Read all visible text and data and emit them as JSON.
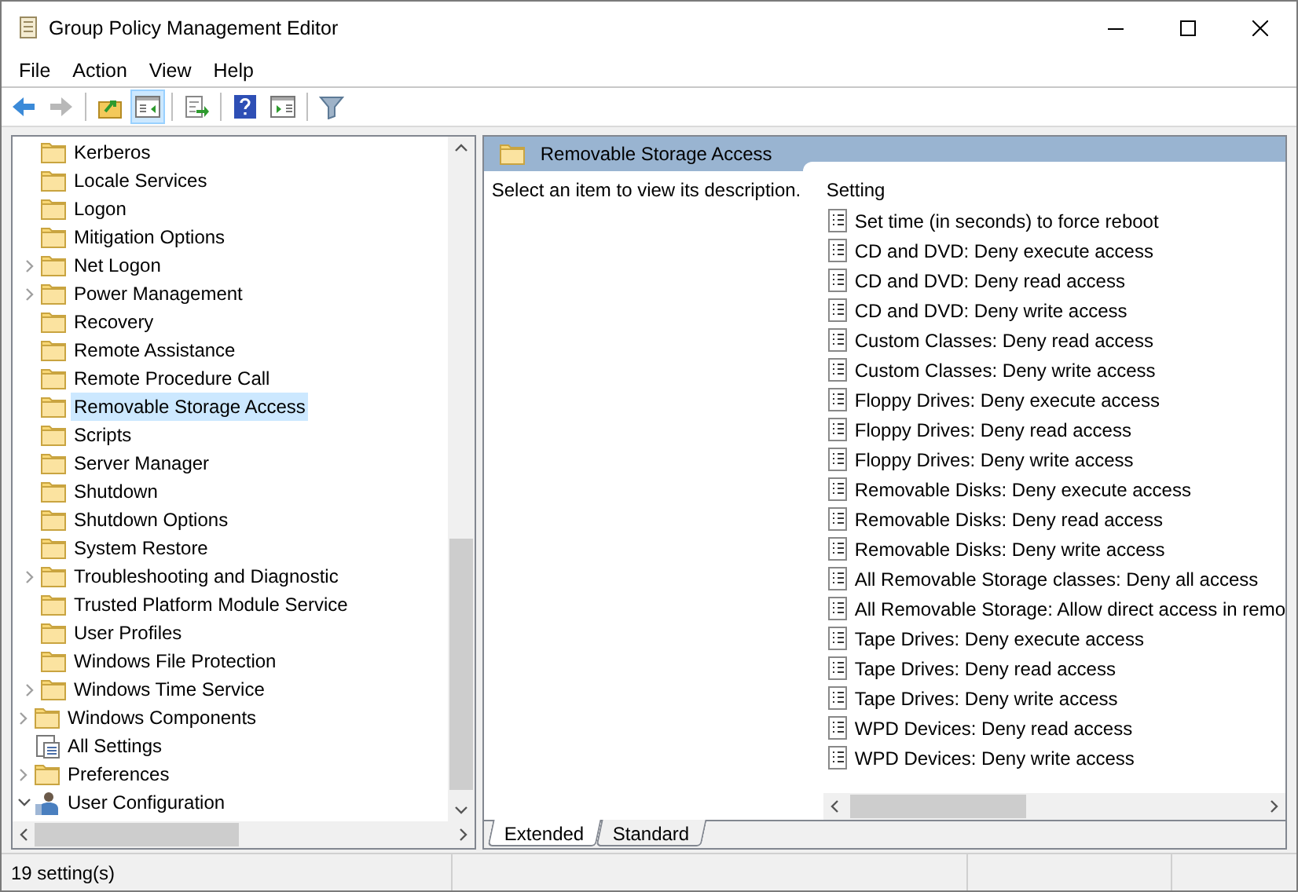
{
  "window": {
    "title": "Group Policy Management Editor"
  },
  "menu": [
    "File",
    "Action",
    "View",
    "Help"
  ],
  "toolbar": [
    {
      "kind": "back",
      "pressed": false,
      "disabled": false
    },
    {
      "kind": "forward",
      "pressed": false,
      "disabled": true
    },
    {
      "kind": "sep"
    },
    {
      "kind": "up",
      "pressed": false,
      "disabled": false
    },
    {
      "kind": "tree",
      "pressed": true,
      "disabled": false
    },
    {
      "kind": "sep"
    },
    {
      "kind": "export",
      "pressed": false,
      "disabled": false
    },
    {
      "kind": "sep"
    },
    {
      "kind": "help",
      "pressed": false,
      "disabled": false
    },
    {
      "kind": "pane",
      "pressed": false,
      "disabled": false
    },
    {
      "kind": "sep"
    },
    {
      "kind": "filter",
      "pressed": false,
      "disabled": false
    }
  ],
  "tree": [
    {
      "children": [
        {
          "children": [
            {
              "children": [
                {
                  "label": "Kerberos",
                  "kind": "folder",
                  "selected": false
                },
                {
                  "label": "Locale Services",
                  "kind": "folder",
                  "selected": false
                },
                {
                  "label": "Logon",
                  "kind": "folder",
                  "selected": false
                },
                {
                  "label": "Mitigation Options",
                  "kind": "folder",
                  "selected": false
                },
                {
                  "label": "Net Logon",
                  "kind": "folder",
                  "expanded": false,
                  "selected": false
                },
                {
                  "label": "Power Management",
                  "kind": "folder",
                  "expanded": false,
                  "selected": false
                },
                {
                  "label": "Recovery",
                  "kind": "folder",
                  "selected": false
                },
                {
                  "label": "Remote Assistance",
                  "kind": "folder",
                  "selected": false
                },
                {
                  "label": "Remote Procedure Call",
                  "kind": "folder",
                  "selected": false
                },
                {
                  "label": "Removable Storage Access",
                  "kind": "folder",
                  "selected": true
                },
                {
                  "label": "Scripts",
                  "kind": "folder",
                  "selected": false
                },
                {
                  "label": "Server Manager",
                  "kind": "folder",
                  "selected": false
                },
                {
                  "label": "Shutdown",
                  "kind": "folder",
                  "selected": false
                },
                {
                  "label": "Shutdown Options",
                  "kind": "folder",
                  "selected": false
                },
                {
                  "label": "System Restore",
                  "kind": "folder",
                  "selected": false
                },
                {
                  "label": "Troubleshooting and Diagnostic",
                  "kind": "folder",
                  "expanded": false,
                  "selected": false
                },
                {
                  "label": "Trusted Platform Module Service",
                  "kind": "folder",
                  "selected": false
                },
                {
                  "label": "User Profiles",
                  "kind": "folder",
                  "selected": false
                },
                {
                  "label": "Windows File Protection",
                  "kind": "folder",
                  "selected": false
                },
                {
                  "label": "Windows Time Service",
                  "kind": "folder",
                  "expanded": false,
                  "selected": false
                }
              ]
            },
            {
              "label": "Windows Components",
              "kind": "folder",
              "expanded": false,
              "selected": false
            },
            {
              "label": "All Settings",
              "kind": "settings",
              "selected": false
            }
          ]
        },
        {
          "label": "Preferences",
          "kind": "folder",
          "expanded": false,
          "selected": false
        }
      ]
    },
    {
      "label": "User Configuration",
      "kind": "user",
      "expanded": true,
      "selected": false
    }
  ],
  "details": {
    "title": "Removable Storage Access",
    "description": "Select an item to view its description.",
    "column": "Setting",
    "settings": [
      "Set time (in seconds) to force reboot",
      "CD and DVD: Deny execute access",
      "CD and DVD: Deny read access",
      "CD and DVD: Deny write access",
      "Custom Classes: Deny read access",
      "Custom Classes: Deny write access",
      "Floppy Drives: Deny execute access",
      "Floppy Drives: Deny read access",
      "Floppy Drives: Deny write access",
      "Removable Disks: Deny execute access",
      "Removable Disks: Deny read access",
      "Removable Disks: Deny write access",
      "All Removable Storage classes: Deny all access",
      "All Removable Storage: Allow direct access in remo",
      "Tape Drives: Deny execute access",
      "Tape Drives: Deny read access",
      "Tape Drives: Deny write access",
      "WPD Devices: Deny read access",
      "WPD Devices: Deny write access"
    ]
  },
  "tabs": [
    {
      "label": "Extended",
      "selected": true
    },
    {
      "label": "Standard",
      "selected": false
    }
  ],
  "status_bar": "19 setting(s)"
}
